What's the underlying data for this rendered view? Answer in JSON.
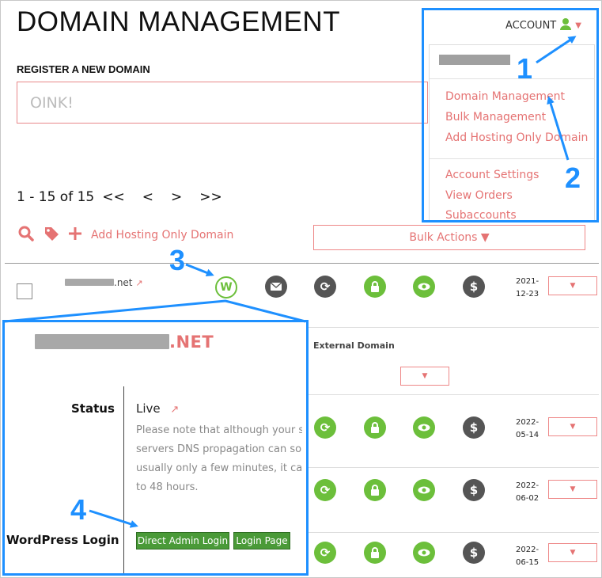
{
  "page": {
    "title": "DOMAIN MANAGEMENT",
    "register_label": "REGISTER A NEW DOMAIN",
    "search_placeholder": "OINK!"
  },
  "pagination": {
    "range": "1 - 15 of 15",
    "first": "<<",
    "prev": "<",
    "next": ">",
    "last": ">>"
  },
  "toolbar": {
    "add_hosting_label": "Add Hosting Only Domain",
    "bulk_actions_label": "Bulk Actions ▼"
  },
  "account": {
    "label": "ACCOUNT",
    "menu": {
      "items_group1": [
        "Domain Management",
        "Bulk Management",
        "Add Hosting Only Domain"
      ],
      "items_group2": [
        "Account Settings",
        "View Orders",
        "Subaccounts"
      ]
    }
  },
  "rows": [
    {
      "domain_suffix": ".net",
      "date": [
        "2021-",
        "12-23"
      ]
    },
    {
      "external_label": "External Domain"
    },
    {
      "date": [
        "2022-",
        "05-14"
      ]
    },
    {
      "date": [
        "2022-",
        "06-02"
      ]
    },
    {
      "date": [
        "2022-",
        "06-15"
      ]
    }
  ],
  "dropdown_arrow": "▼",
  "popup": {
    "domain_suffix": ".NET",
    "status_label": "Status",
    "status_value": "Live",
    "note_lines": [
      "Please note that although your site",
      "servers DNS propagation can som",
      "usually only a few minutes, it can s",
      "to 48 hours."
    ],
    "wp_login_label": "WordPress Login",
    "direct_admin_btn": "Direct Admin Login",
    "login_page_btn": "Login Page"
  },
  "callouts": [
    "1",
    "2",
    "3",
    "4"
  ],
  "colors": {
    "accent": "#e57373",
    "green": "#6cbf3b",
    "highlight": "#1e90ff"
  },
  "icons": [
    "search-icon",
    "tag-icon",
    "plus-icon",
    "wordpress-icon",
    "mail-icon",
    "refresh-icon",
    "lock-icon",
    "eye-icon",
    "dollar-icon",
    "user-icon",
    "external-link-icon"
  ]
}
